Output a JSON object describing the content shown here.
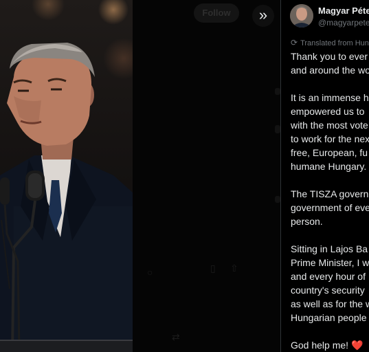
{
  "tweet": {
    "author_name": "Magyar Péte",
    "author_handle": "@magyarpete",
    "translated_label": "Translated from Hun",
    "paragraphs": [
      [
        "Thank you to ever",
        "and around the wo"
      ],
      [
        "It is an immense h",
        "empowered us to",
        "with the most vote",
        "to work for the nex",
        "free, European, fu",
        "humane Hungary."
      ],
      [
        "The TISZA governm",
        "government of eve",
        "person."
      ],
      [
        "Sitting in Lajos Ba",
        "Prime Minister, I w",
        "and every hour of",
        "country's security",
        "as well as for the w",
        "Hungarian people"
      ]
    ],
    "closing": "God help me!",
    "closing_emoji": "❤️"
  },
  "background_tweet": {
    "follow_label": "Follow"
  },
  "controls": {
    "expand_icon": "»"
  },
  "colors": {
    "text_primary": "#e7e9ea",
    "text_secondary": "#71767b",
    "heart": "#f91880"
  }
}
